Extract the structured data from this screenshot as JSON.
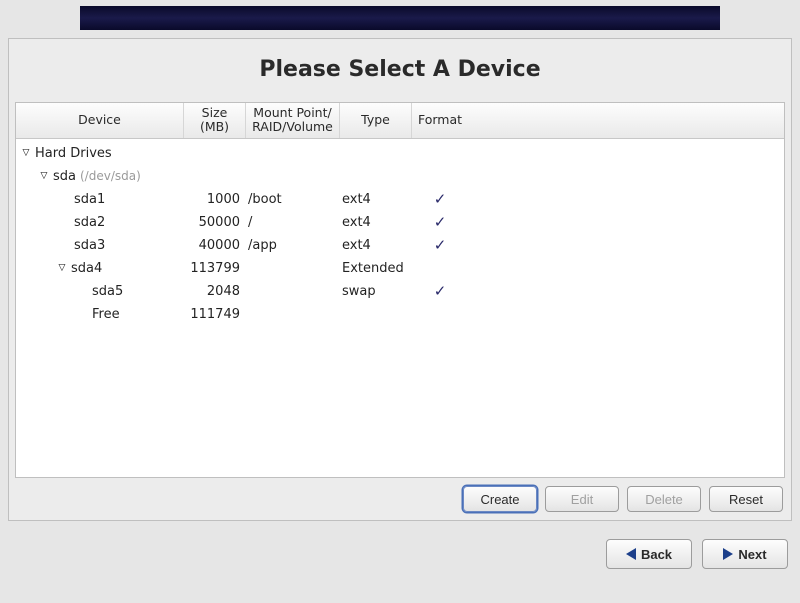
{
  "title": "Please Select A Device",
  "columns": {
    "device": "Device",
    "size": "Size\n(MB)",
    "mount": "Mount Point/\nRAID/Volume",
    "type": "Type",
    "format": "Format"
  },
  "tree": {
    "root_label": "Hard Drives",
    "disk": {
      "name": "sda",
      "path": "(/dev/sda)",
      "partitions": [
        {
          "name": "sda1",
          "size": "1000",
          "mount": "/boot",
          "type": "ext4",
          "format": true,
          "indent": 3,
          "expand": null
        },
        {
          "name": "sda2",
          "size": "50000",
          "mount": "/",
          "type": "ext4",
          "format": true,
          "indent": 3,
          "expand": null
        },
        {
          "name": "sda3",
          "size": "40000",
          "mount": "/app",
          "type": "ext4",
          "format": true,
          "indent": 3,
          "expand": null
        },
        {
          "name": "sda4",
          "size": "113799",
          "mount": "",
          "type": "Extended",
          "format": false,
          "indent": 2,
          "expand": true
        },
        {
          "name": "sda5",
          "size": "2048",
          "mount": "",
          "type": "swap",
          "format": true,
          "indent": 4,
          "expand": null
        },
        {
          "name": "Free",
          "size": "111749",
          "mount": "",
          "type": "",
          "format": false,
          "indent": 4,
          "expand": null
        }
      ]
    }
  },
  "buttons": {
    "create": "Create",
    "edit": "Edit",
    "delete": "Delete",
    "reset": "Reset",
    "back": "Back",
    "next": "Next"
  }
}
